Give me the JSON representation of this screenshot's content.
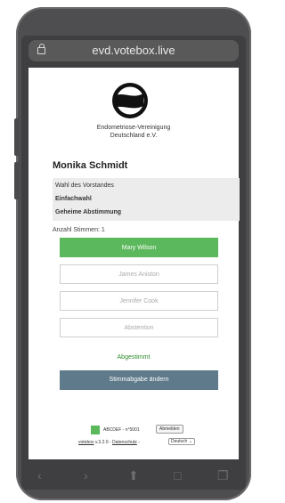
{
  "browser": {
    "url": "evd.votebox.live"
  },
  "organization": {
    "line1": "Endometriose-Vereinigung",
    "line2": "Deutschland e.V."
  },
  "voter_name": "Monika Schmidt",
  "election": {
    "title": "Wahl des Vorstandes",
    "type": "Einfachwahl",
    "mode": "Geheime Abstimmung"
  },
  "vote_count_label": "Anzahl Stimmen: 1",
  "options": [
    {
      "label": "Mary Wilson",
      "selected": true
    },
    {
      "label": "James Aniston",
      "selected": false
    },
    {
      "label": "Jennifer Cook",
      "selected": false
    },
    {
      "label": "Abstention",
      "selected": false
    }
  ],
  "status_text": "Abgestimmt",
  "change_button": "Stimmabgabe ändern",
  "footer": {
    "code": "ABCDEF - n°5001",
    "logout": "Abmelden",
    "brand": "votebox",
    "version": " v.3.2.0 - ",
    "privacy": "Datenschutz",
    "sep": " - ",
    "language": "Deutsch"
  },
  "colors": {
    "selected": "#5cb85c",
    "change_button": "#5f7a8a",
    "voted_text": "#2e8b2e"
  },
  "toolbar_icons": [
    "back-arrow-icon",
    "forward-arrow-icon",
    "share-icon",
    "bookmarks-icon",
    "tabs-icon"
  ]
}
